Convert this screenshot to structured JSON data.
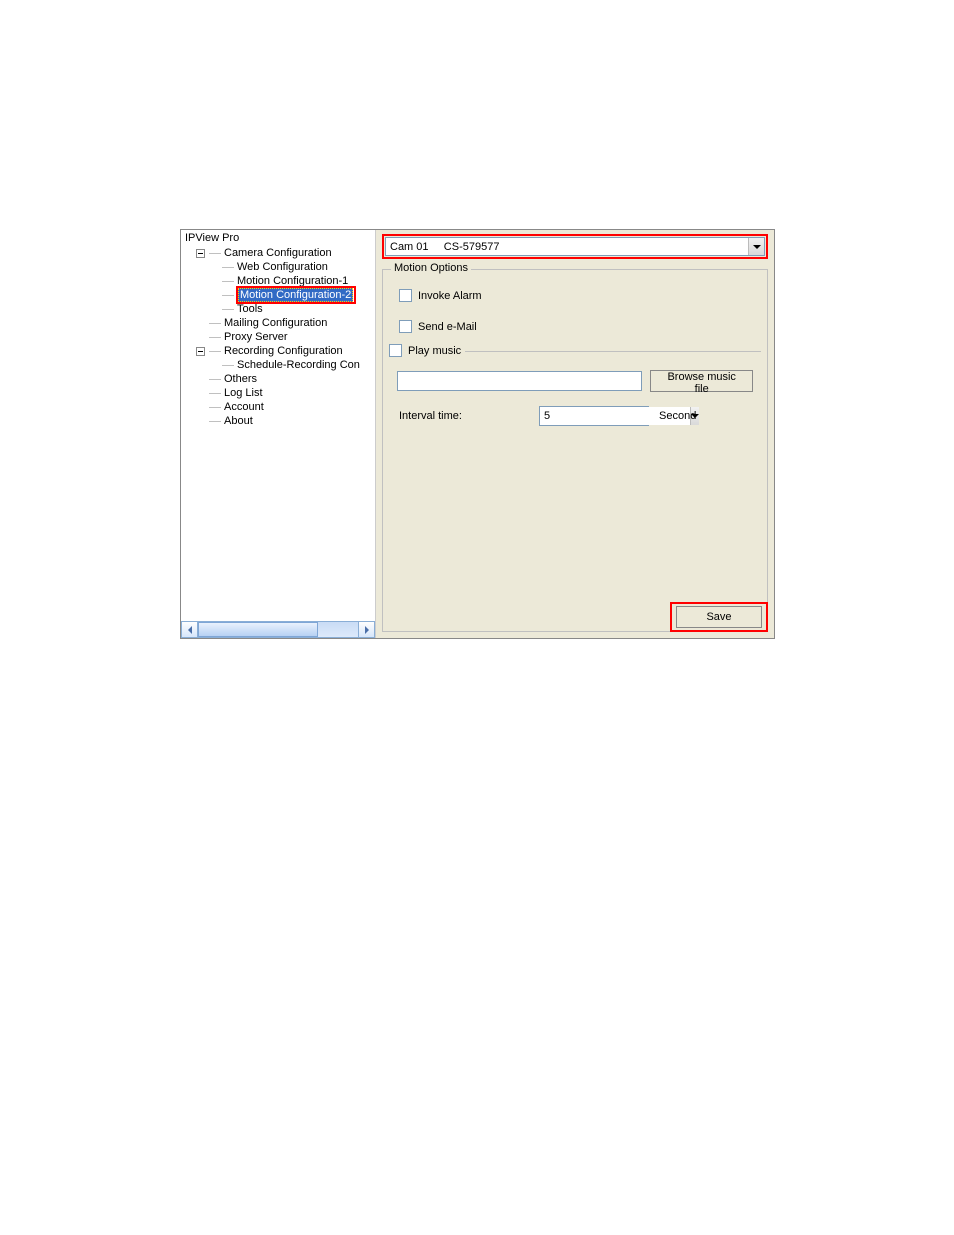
{
  "app_title": "IPView Pro",
  "tree": {
    "camera_config": "Camera Configuration",
    "web_config": "Web Configuration",
    "motion_config_1": "Motion Configuration-1",
    "motion_config_2": "Motion Configuration-2",
    "tools": "Tools",
    "mailing_config": "Mailing Configuration",
    "proxy_server": "Proxy Server",
    "recording_config": "Recording Configuration",
    "schedule_rec": "Schedule-Recording Con",
    "others": "Others",
    "log_list": "Log List",
    "account": "Account",
    "about": "About"
  },
  "camera_selector": {
    "value": "Cam 01     CS-579577"
  },
  "motion_options": {
    "group_label": "Motion Options",
    "invoke_alarm_label": "Invoke Alarm",
    "send_email_label": "Send e-Mail",
    "play_music_label": "Play music",
    "music_path": "",
    "browse_label": "Browse music file",
    "interval_label": "Interval time:",
    "interval_value": "5",
    "interval_unit": "Second"
  },
  "save_label": "Save"
}
